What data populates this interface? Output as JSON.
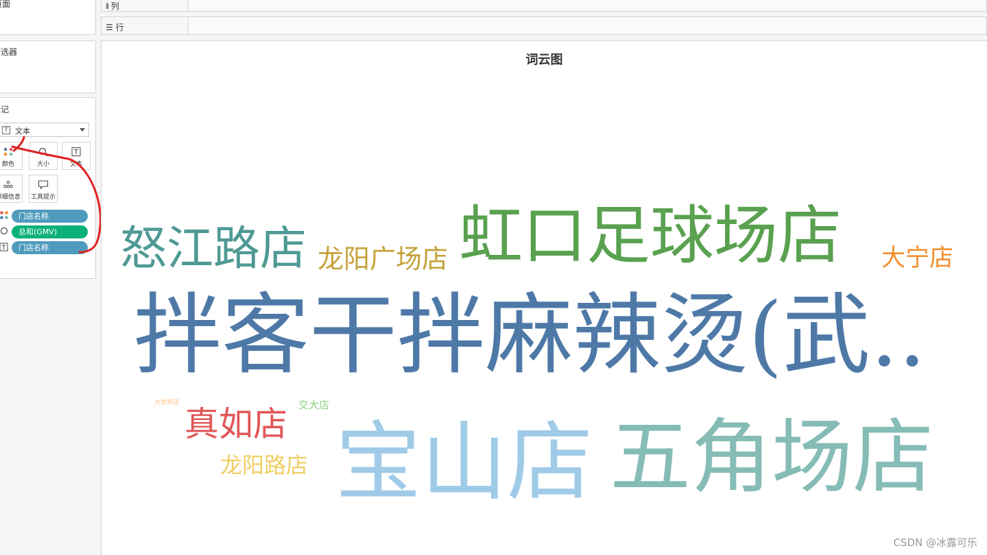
{
  "left_panel": {
    "pages_title": "页面",
    "filters_title": "筛选器",
    "marks_title": "标记",
    "mark_type": "文本",
    "mark_buttons": [
      {
        "label": "颜色",
        "icon": "color-dots-icon"
      },
      {
        "label": "大小",
        "icon": "size-magnifier-icon"
      },
      {
        "label": "文本",
        "icon": "text-t-icon"
      },
      {
        "label": "详细信息",
        "icon": "detail-dots-icon"
      },
      {
        "label": "工具提示",
        "icon": "tooltip-bubble-icon"
      }
    ],
    "fields": [
      {
        "label": "门店名称",
        "color": "#4f9bbd",
        "icon": "color-dots-icon"
      },
      {
        "label": "总和(GMV)",
        "color": "#0bb07a",
        "icon": "size-magnifier-icon"
      },
      {
        "label": "门店名称",
        "color": "#4f9bbd",
        "icon": "text-t-icon"
      }
    ]
  },
  "shelves": {
    "columns_label": "列",
    "rows_label": "行"
  },
  "viz": {
    "title": "词云图",
    "words": [
      {
        "text": "怒江路店",
        "color": "#4f9a94"
      },
      {
        "text": "龙阳广场店",
        "color": "#c4a23a"
      },
      {
        "text": "虹口足球场店",
        "color": "#59a14f"
      },
      {
        "text": "大宁店",
        "color": "#f28e2b"
      },
      {
        "text": "拌客干拌麻辣烫(武..",
        "color": "#4e79a7"
      },
      {
        "text": "大世界店",
        "color": "#ffbe7d"
      },
      {
        "text": "交大店",
        "color": "#8cd17d"
      },
      {
        "text": "真如店",
        "color": "#e15759"
      },
      {
        "text": "龙阳路店",
        "color": "#f1ce63"
      },
      {
        "text": "宝山店",
        "color": "#a0cbe8"
      },
      {
        "text": "五角场店",
        "color": "#86bcb6"
      }
    ]
  },
  "watermark": "CSDN @冰露可乐"
}
